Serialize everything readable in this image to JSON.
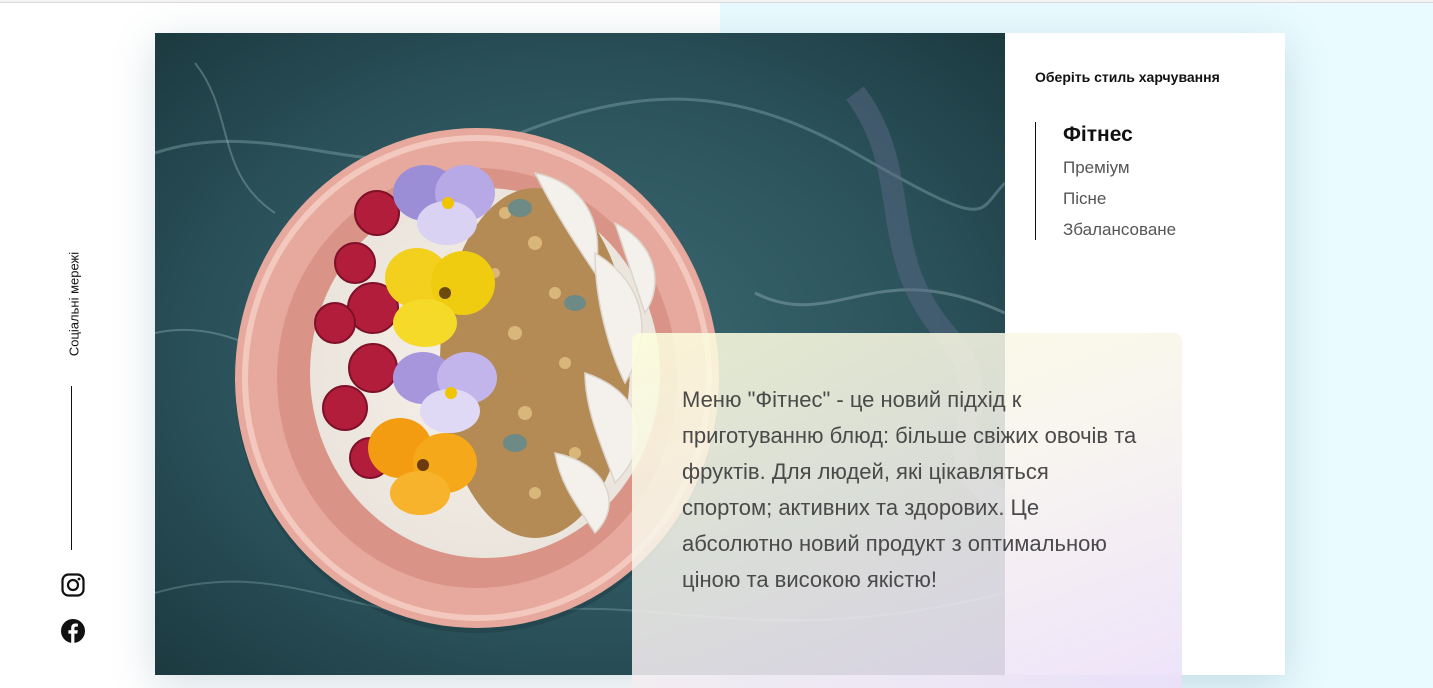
{
  "sidebar": {
    "social_label": "Соціальні мережі",
    "icons": [
      "instagram-icon",
      "facebook-icon"
    ]
  },
  "menu": {
    "title": "Оберіть стиль харчування",
    "items": [
      {
        "label": "Фітнес",
        "active": true
      },
      {
        "label": "Преміум",
        "active": false
      },
      {
        "label": "Пісне",
        "active": false
      },
      {
        "label": "Збалансоване",
        "active": false
      }
    ]
  },
  "description": {
    "text": "Меню \"Фітнес\" - це новий підхід к приготуванню блюд: більше свіжих овочів та фруктів. Для людей, які цікавляться спортом; активних та здорових. Це абсолютно новий продукт з оптимальною ціною та високою якістю!"
  },
  "colors": {
    "accent_tint": "#e9fbff",
    "text_dark": "#111111",
    "text_muted": "#555555",
    "marble": "#2f5a63",
    "bowl": "#e6a79c"
  }
}
